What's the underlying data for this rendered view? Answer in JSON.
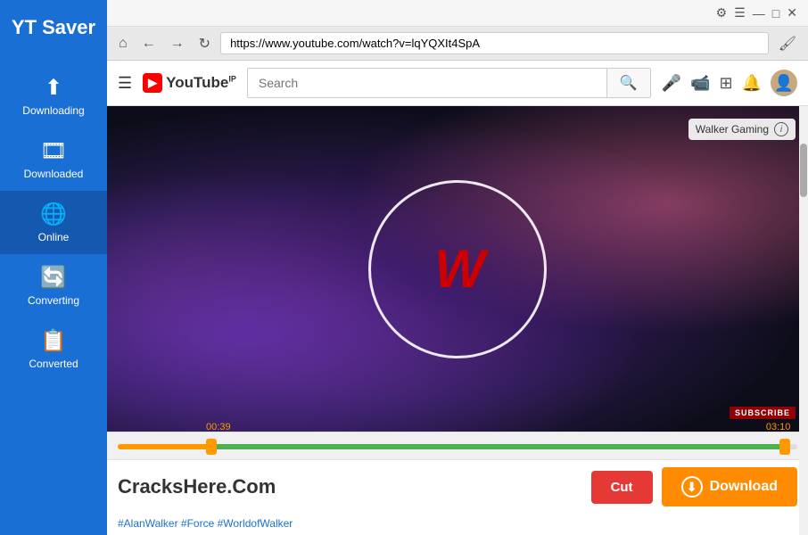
{
  "sidebar": {
    "title": "YT Saver",
    "items": [
      {
        "id": "downloading",
        "label": "Downloading",
        "icon": "⬆"
      },
      {
        "id": "downloaded",
        "label": "Downloaded",
        "icon": "🎞"
      },
      {
        "id": "online",
        "label": "Online",
        "icon": "🌐"
      },
      {
        "id": "converting",
        "label": "Converting",
        "icon": "🔄"
      },
      {
        "id": "converted",
        "label": "Converted",
        "icon": "📋"
      }
    ],
    "active": "online"
  },
  "browser": {
    "url": "https://www.youtube.com/watch?v=lqYQXIt4SpA",
    "back_icon": "←",
    "forward_icon": "→",
    "refresh_icon": "↻",
    "home_icon": "⌂",
    "paint_icon": "🖌"
  },
  "youtube": {
    "search_placeholder": "Search",
    "channel_name": "Walker Gaming",
    "time_start": "00:39",
    "time_end": "03:10",
    "tags": "#AlanWalker #Force #WorldofWalker",
    "subscribe_label": "SUBSCRIBE"
  },
  "toolbar": {
    "cut_label": "Cut",
    "download_label": "Download"
  },
  "watermark": {
    "text": "CracksHere.Com"
  },
  "window": {
    "settings_icon": "⚙",
    "menu_icon": "☰",
    "minimize_icon": "—",
    "maximize_icon": "□",
    "close_icon": "✕"
  }
}
